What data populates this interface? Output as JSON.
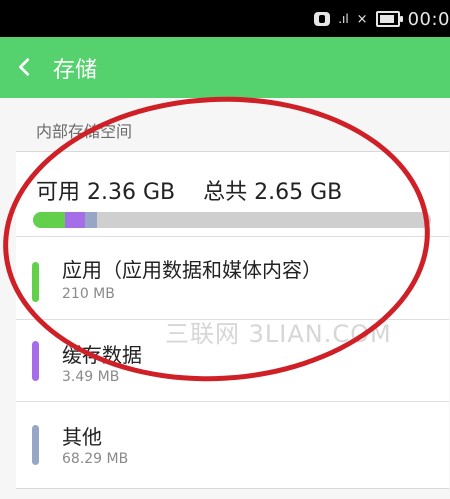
{
  "status": {
    "time": "00:0",
    "signal": ".ıl",
    "nosignal": "×"
  },
  "appbar": {
    "title": "存储"
  },
  "section": {
    "label": "内部存储空间"
  },
  "storage": {
    "available": "可用 2.36 GB",
    "total": "总共 2.65 GB"
  },
  "usage_bar": {
    "available_gb": 2.36,
    "total_gb": 2.65,
    "segments": [
      {
        "name": "apps",
        "color": "#62d04a"
      },
      {
        "name": "cache",
        "color": "#a56ee8"
      },
      {
        "name": "other",
        "color": "#97a6c5"
      }
    ]
  },
  "items": [
    {
      "title": "应用（应用数据和媒体内容）",
      "size": "210 MB",
      "color": "#62d04a"
    },
    {
      "title": "缓存数据",
      "size": "3.49 MB",
      "color": "#a56ee8"
    },
    {
      "title": "其他",
      "size": "68.29 MB",
      "color": "#97a6c5"
    }
  ],
  "watermark": "三联网 3LIAN.COM"
}
